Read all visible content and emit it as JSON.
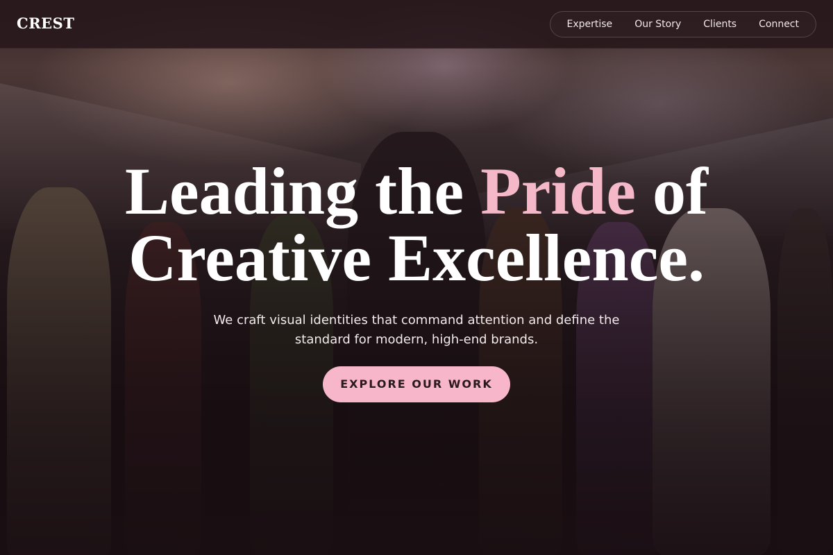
{
  "header": {
    "logo": "CREST",
    "nav": [
      {
        "label": "Expertise"
      },
      {
        "label": "Our Story"
      },
      {
        "label": "Clients"
      },
      {
        "label": "Connect"
      }
    ]
  },
  "hero": {
    "headline_part1": "Leading the ",
    "headline_accent": "Pride",
    "headline_part2": " of",
    "headline_line2": "Creative Excellence.",
    "subtext": "We craft visual identities that command attention and define the standard for modern, high-end brands.",
    "cta_label": "EXPLORE OUR WORK"
  },
  "colors": {
    "accent": "#f4b8c8",
    "button_bg": "#f7b6c9",
    "header_bg": "#28181c"
  }
}
